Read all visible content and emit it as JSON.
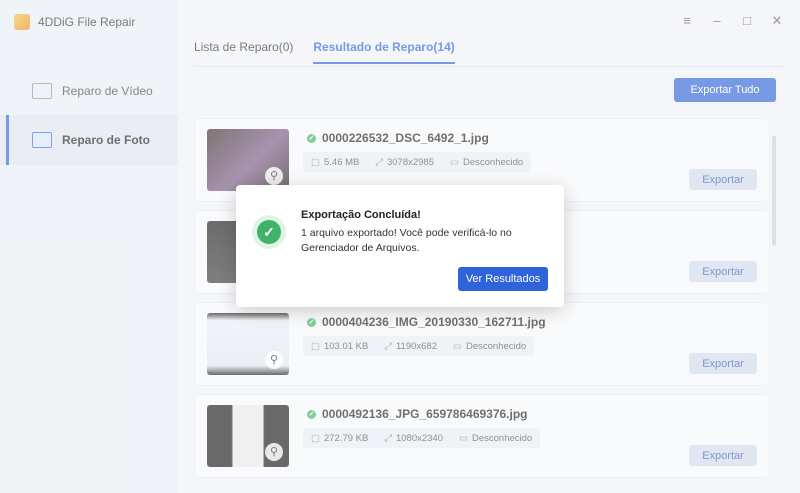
{
  "app": {
    "title": "4DDiG File Repair"
  },
  "sidebar": {
    "items": [
      {
        "label": "Reparo de Vídeo",
        "icon": "video-icon"
      },
      {
        "label": "Reparo de Foto",
        "icon": "photo-icon"
      }
    ]
  },
  "window_controls": [
    "menu-icon",
    "minimize-icon",
    "maximize-icon",
    "close-icon"
  ],
  "tabs": [
    {
      "label": "Lista de Reparo(0)"
    },
    {
      "label": "Resultado de Reparo(14)"
    }
  ],
  "toolbar": {
    "export_all_label": "Exportar Tudo"
  },
  "files": [
    {
      "name": "0000226532_DSC_6492_1.jpg",
      "size": "5.46 MB",
      "dims": "3078x2985",
      "device": "Desconhecido",
      "export_label": "Exportar"
    },
    {
      "name": "",
      "size": "",
      "dims": "",
      "device": "",
      "export_label": "Exportar"
    },
    {
      "name": "0000404236_IMG_20190330_162711.jpg",
      "size": "103.01 KB",
      "dims": "1190x682",
      "device": "Desconhecido",
      "export_label": "Exportar"
    },
    {
      "name": "0000492136_JPG_659786469376.jpg",
      "size": "272.79 KB",
      "dims": "1080x2340",
      "device": "Desconhecido",
      "export_label": "Exportar"
    }
  ],
  "modal": {
    "title": "Exportação Concluída!",
    "body": "1 arquivo exportado! Você pode verificá-lo no Gerenciador de Arquivos.",
    "button_label": "Ver Resultados"
  },
  "colors": {
    "accent": "#2f63d9",
    "success": "#3fb36a"
  }
}
